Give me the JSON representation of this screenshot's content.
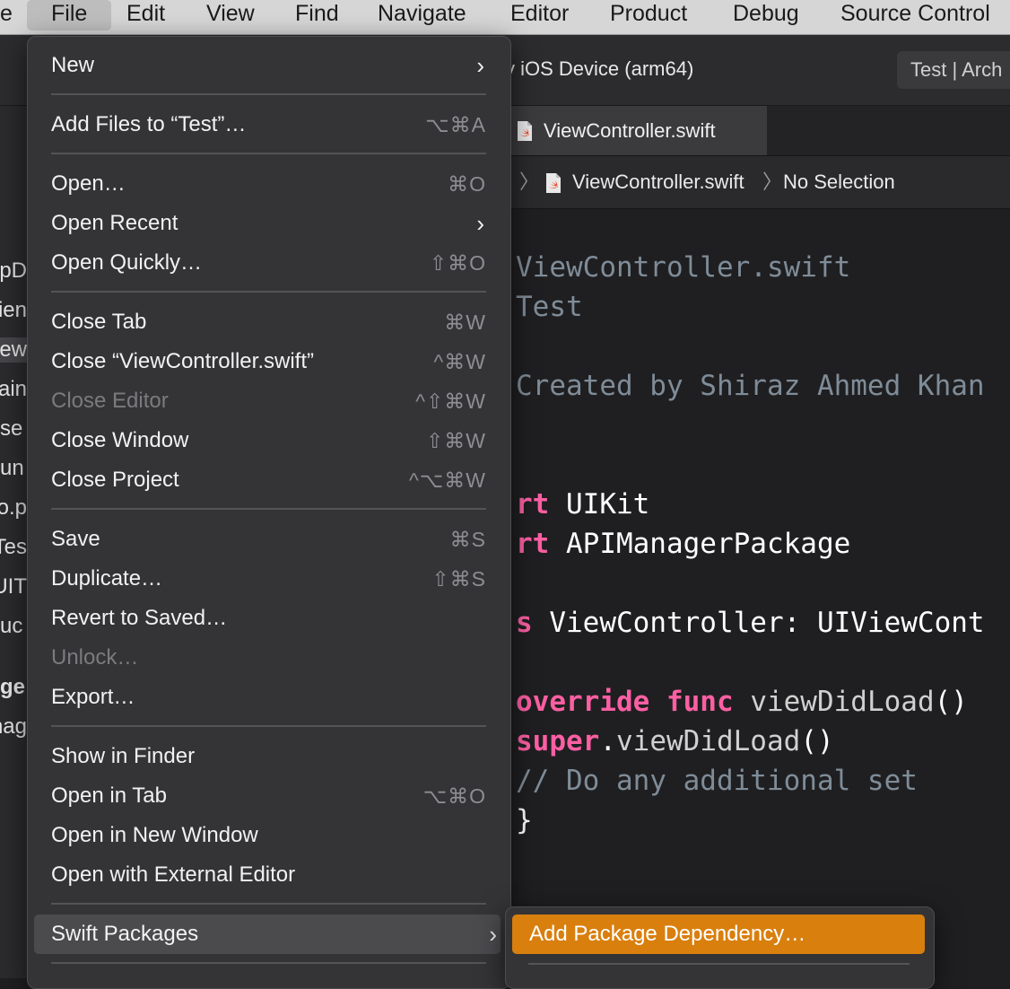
{
  "menubar": {
    "items": [
      "e",
      "File",
      "Edit",
      "View",
      "Find",
      "Navigate",
      "Editor",
      "Product",
      "Debug",
      "Source Control"
    ],
    "active": "File"
  },
  "toolbar": {
    "scheme_text": "y iOS Device (arm64)",
    "status_text": "Test | Arch"
  },
  "tab": {
    "label": "ViewController.swift"
  },
  "jumpbar": {
    "file": "ViewController.swift",
    "selection": "No Selection"
  },
  "navigator_fragments": [
    "ppD",
    "ien",
    "ew",
    "ain",
    "se",
    "un",
    "o.p",
    "Tes",
    "UIT",
    "uc",
    "ge",
    "nag"
  ],
  "code_lines": [
    {
      "text": "ViewController.swift",
      "style": "comment"
    },
    {
      "text": "Test",
      "style": "comment"
    },
    {
      "text": "",
      "style": "comment"
    },
    {
      "text": "Created by Shiraz Ahmed Khan",
      "style": "comment"
    },
    {
      "text": "",
      "style": "plain"
    },
    {
      "text": "rt UIKit",
      "style": "plain"
    },
    {
      "text": "rt APIManagerPackage",
      "style": "plain"
    },
    {
      "text": "",
      "style": "plain"
    },
    {
      "text": "s ViewController: UIViewCont",
      "style": "plain"
    },
    {
      "text": "",
      "style": "plain"
    },
    {
      "text": "override func viewDidLoad()",
      "style": "mixed1"
    },
    {
      "text": "    super.viewDidLoad()",
      "style": "mixed2"
    },
    {
      "text": "    // Do any additional set",
      "style": "comment"
    },
    {
      "text": "}",
      "style": "plain"
    }
  ],
  "menu": {
    "new": {
      "label": "New"
    },
    "add_files": {
      "label": "Add Files to “Test”…",
      "shortcut": "⌥⌘A"
    },
    "open": {
      "label": "Open…",
      "shortcut": "⌘O"
    },
    "open_recent": {
      "label": "Open Recent"
    },
    "open_quickly": {
      "label": "Open Quickly…",
      "shortcut": "⇧⌘O"
    },
    "close_tab": {
      "label": "Close Tab",
      "shortcut": "⌘W"
    },
    "close_file": {
      "label": "Close “ViewController.swift”",
      "shortcut": "^⌘W"
    },
    "close_editor": {
      "label": "Close Editor",
      "shortcut": "^⇧⌘W"
    },
    "close_window": {
      "label": "Close Window",
      "shortcut": "⇧⌘W"
    },
    "close_project": {
      "label": "Close Project",
      "shortcut": "^⌥⌘W"
    },
    "save": {
      "label": "Save",
      "shortcut": "⌘S"
    },
    "duplicate": {
      "label": "Duplicate…",
      "shortcut": "⇧⌘S"
    },
    "revert": {
      "label": "Revert to Saved…"
    },
    "unlock": {
      "label": "Unlock…"
    },
    "export": {
      "label": "Export…"
    },
    "show_in_finder": {
      "label": "Show in Finder"
    },
    "open_in_tab": {
      "label": "Open in Tab",
      "shortcut": "⌥⌘O"
    },
    "open_new_window": {
      "label": "Open in New Window"
    },
    "open_external": {
      "label": "Open with External Editor"
    },
    "swift_packages": {
      "label": "Swift Packages"
    },
    "arrow": "›"
  },
  "submenu": {
    "add_dependency": "Add Package Dependency…"
  },
  "colors": {
    "accent": "#d97f0e",
    "menu_bg": "#343437",
    "menubar_bg": "#d6d6d6"
  }
}
